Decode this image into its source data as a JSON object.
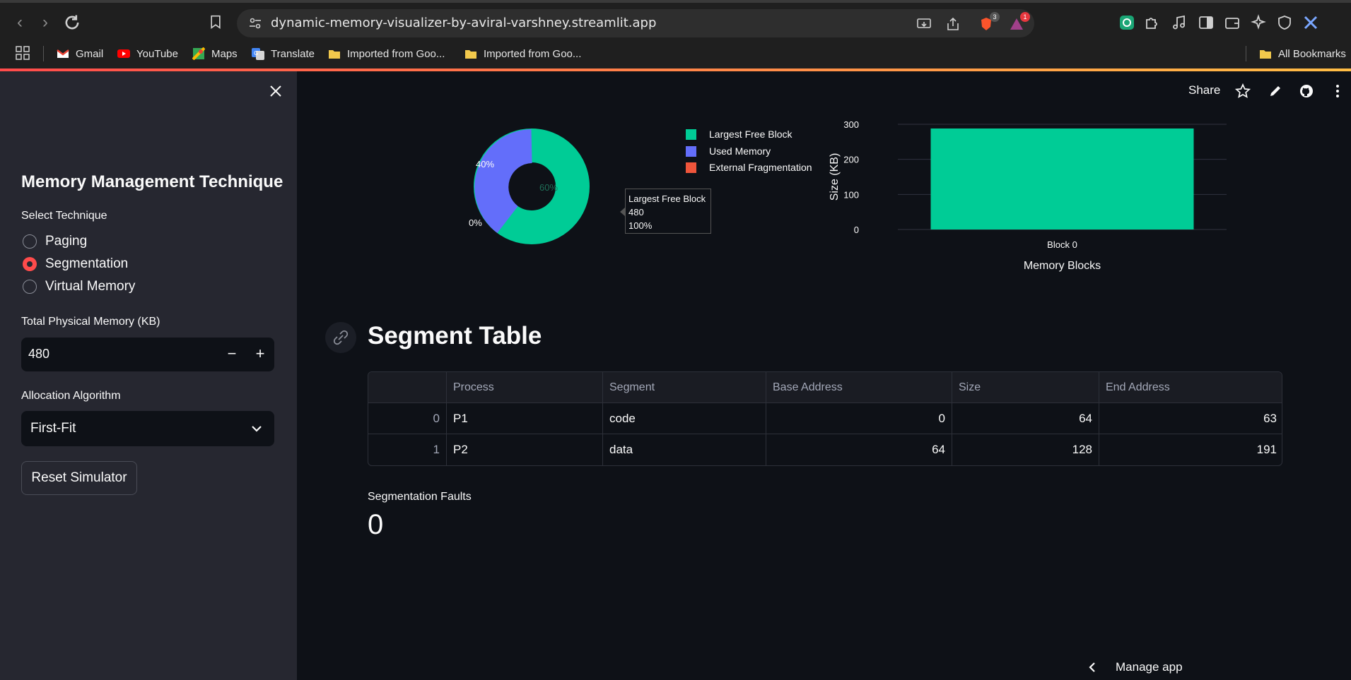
{
  "browser": {
    "url": "dynamic-memory-visualizer-by-aviral-varshney.streamlit.app",
    "extension_badges": [
      "3",
      "1"
    ],
    "bookmarks": [
      {
        "label": "Gmail",
        "icon": "gmail-icon"
      },
      {
        "label": "YouTube",
        "icon": "youtube-icon"
      },
      {
        "label": "Maps",
        "icon": "maps-icon"
      },
      {
        "label": "Translate",
        "icon": "translate-icon"
      },
      {
        "label": "Imported from Goo...",
        "icon": "folder-icon"
      },
      {
        "label": "Imported from Goo...",
        "icon": "folder-icon"
      }
    ],
    "all_bookmarks": "All Bookmarks"
  },
  "sidebar": {
    "title": "Memory Management Technique",
    "technique_label": "Select Technique",
    "techniques": [
      "Paging",
      "Segmentation",
      "Virtual Memory"
    ],
    "selected_technique": "Segmentation",
    "memory_label": "Total Physical Memory (KB)",
    "memory_value": "480",
    "algorithm_label": "Allocation Algorithm",
    "algorithm_value": "First-Fit",
    "reset_label": "Reset Simulator"
  },
  "header": {
    "share_label": "Share"
  },
  "pie": {
    "labels": {
      "used": "40%",
      "free": "60%",
      "frag": "0%"
    },
    "legend": [
      "Largest Free Block",
      "Used Memory",
      "External Fragmentation"
    ],
    "colors": {
      "free": "#00cc96",
      "used": "#636efa",
      "frag": "#ef553b"
    },
    "tooltip": {
      "name": "Largest Free Block",
      "value": "480",
      "pct": "100%"
    }
  },
  "chart_data": {
    "type": "bar",
    "categories": [
      "Block 0"
    ],
    "values": [
      288
    ],
    "xlabel": "Memory Blocks",
    "ylabel": "Size (KB)",
    "ylim": [
      0,
      300
    ],
    "yticks": [
      "0",
      "100",
      "200",
      "300"
    ],
    "color": "#00cc96"
  },
  "segment_table": {
    "title": "Segment Table",
    "columns": [
      "",
      "Process",
      "Segment",
      "Base Address",
      "Size",
      "End Address"
    ],
    "rows": [
      [
        "0",
        "P1",
        "code",
        "0",
        "64",
        "63"
      ],
      [
        "1",
        "P2",
        "data",
        "64",
        "128",
        "191"
      ]
    ]
  },
  "metric": {
    "label": "Segmentation Faults",
    "value": "0"
  },
  "footer": {
    "manage_label": "Manage app"
  }
}
